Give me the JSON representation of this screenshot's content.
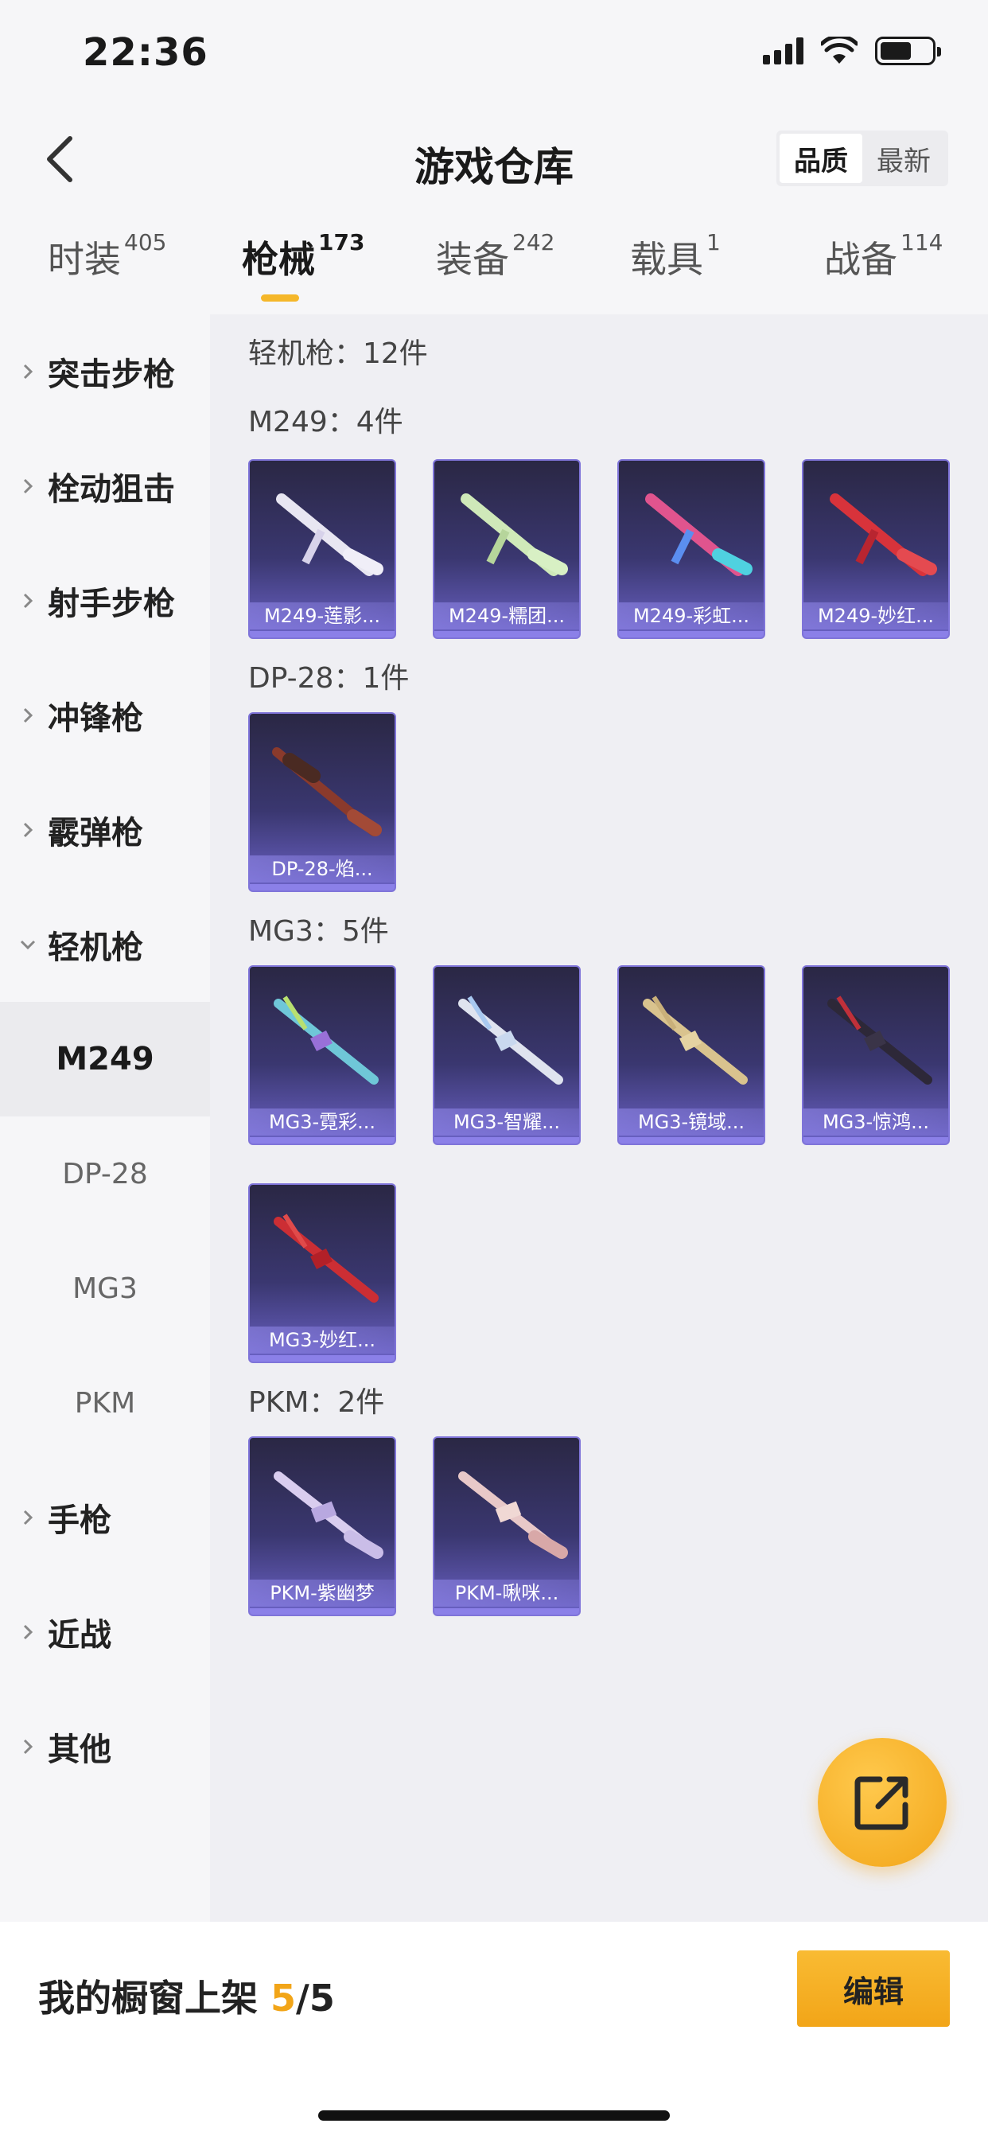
{
  "status": {
    "time": "22:36"
  },
  "header": {
    "title": "游戏仓库",
    "sort_quality": "品质",
    "sort_newest": "最新"
  },
  "tabs": [
    {
      "label": "时装",
      "count": "405"
    },
    {
      "label": "枪械",
      "count": "173"
    },
    {
      "label": "装备",
      "count": "242"
    },
    {
      "label": "载具",
      "count": "1"
    },
    {
      "label": "战备",
      "count": "114"
    }
  ],
  "sidebar": {
    "categories": [
      "突击步枪",
      "栓动狙击",
      "射手步枪",
      "冲锋枪",
      "霰弹枪",
      "轻机枪"
    ],
    "sub": [
      "M249",
      "DP-28",
      "MG3",
      "PKM"
    ],
    "more": [
      "手枪",
      "近战",
      "其他"
    ]
  },
  "content": {
    "summary": "轻机枪：12件",
    "groups": [
      {
        "title": "M249：4件",
        "items": [
          "M249-莲影...",
          "M249-糯团...",
          "M249-彩虹...",
          "M249-妙红..."
        ]
      },
      {
        "title": "DP-28：1件",
        "items": [
          "DP-28-焰..."
        ]
      },
      {
        "title": "MG3：5件",
        "items": [
          "MG3-霓彩...",
          "MG3-智耀...",
          "MG3-镜域...",
          "MG3-惊鸿...",
          "MG3-妙红..."
        ]
      },
      {
        "title": "PKM：2件",
        "items": [
          "PKM-紫幽梦",
          "PKM-啾咪..."
        ]
      }
    ]
  },
  "bottom": {
    "label": "我的橱窗上架 ",
    "current": "5",
    "sep_total": "/5",
    "edit": "编辑"
  },
  "colors": {
    "accent": "#f2a518",
    "card_top": "#2a2744",
    "card_bottom": "#6b62c6"
  }
}
